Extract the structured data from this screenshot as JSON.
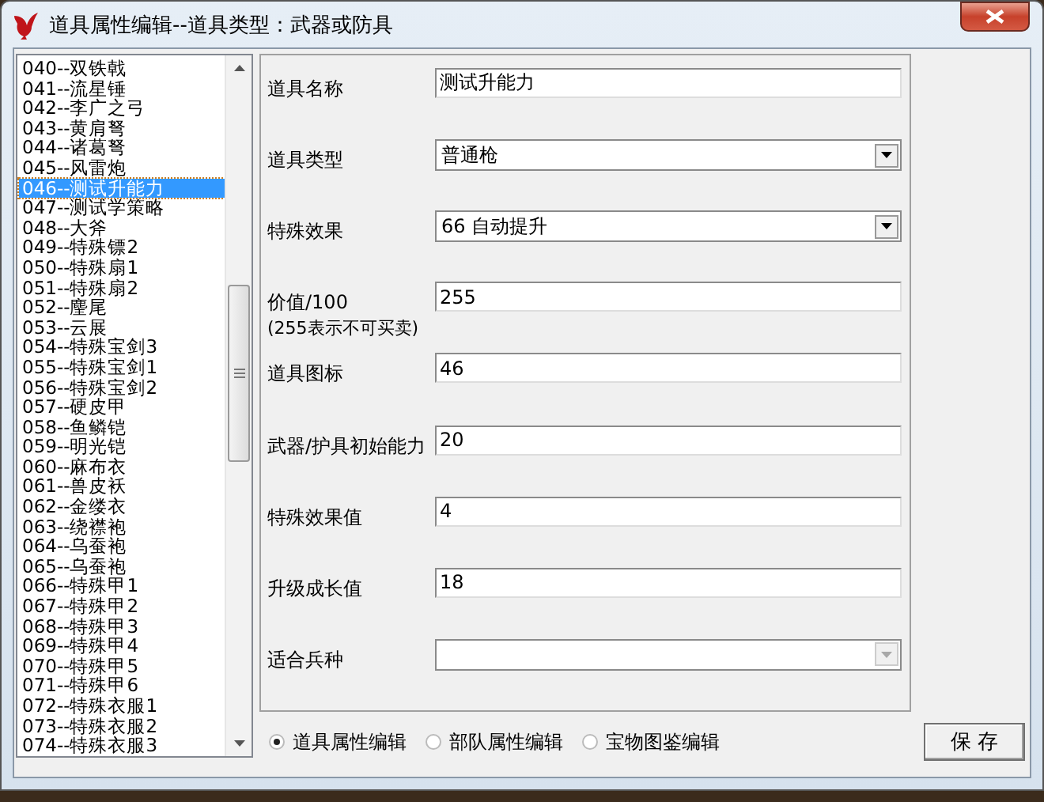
{
  "window": {
    "title": "道具属性编辑--道具类型：武器或防具"
  },
  "items": [
    {
      "label": "040--双铁戟",
      "selected": false
    },
    {
      "label": "041--流星锤",
      "selected": false
    },
    {
      "label": "042--李广之弓",
      "selected": false
    },
    {
      "label": "043--黄肩弩",
      "selected": false
    },
    {
      "label": "044--诸葛弩",
      "selected": false
    },
    {
      "label": "045--风雷炮",
      "selected": false
    },
    {
      "label": "046--测试升能力",
      "selected": true
    },
    {
      "label": "047--测试学策略",
      "selected": false
    },
    {
      "label": "048--大斧",
      "selected": false
    },
    {
      "label": "049--特殊镖2",
      "selected": false
    },
    {
      "label": "050--特殊扇1",
      "selected": false
    },
    {
      "label": "051--特殊扇2",
      "selected": false
    },
    {
      "label": "052--麈尾",
      "selected": false
    },
    {
      "label": "053--云展",
      "selected": false
    },
    {
      "label": "054--特殊宝剑3",
      "selected": false
    },
    {
      "label": "055--特殊宝剑1",
      "selected": false
    },
    {
      "label": "056--特殊宝剑2",
      "selected": false
    },
    {
      "label": "057--硬皮甲",
      "selected": false
    },
    {
      "label": "058--鱼鳞铠",
      "selected": false
    },
    {
      "label": "059--明光铠",
      "selected": false
    },
    {
      "label": "060--麻布衣",
      "selected": false
    },
    {
      "label": "061--兽皮袄",
      "selected": false
    },
    {
      "label": "062--金缕衣",
      "selected": false
    },
    {
      "label": "063--绕襟袍",
      "selected": false
    },
    {
      "label": "064--乌蚕袍",
      "selected": false
    },
    {
      "label": "065--乌蚕袍",
      "selected": false
    },
    {
      "label": "066--特殊甲1",
      "selected": false
    },
    {
      "label": "067--特殊甲2",
      "selected": false
    },
    {
      "label": "068--特殊甲3",
      "selected": false
    },
    {
      "label": "069--特殊甲4",
      "selected": false
    },
    {
      "label": "070--特殊甲5",
      "selected": false
    },
    {
      "label": "071--特殊甲6",
      "selected": false
    },
    {
      "label": "072--特殊衣服1",
      "selected": false
    },
    {
      "label": "073--特殊衣服2",
      "selected": false
    },
    {
      "label": "074--特殊衣服3",
      "selected": false
    }
  ],
  "fields": [
    {
      "kind": "text",
      "label": "道具名称",
      "value": "测试升能力"
    },
    {
      "kind": "combo",
      "label": "道具类型",
      "value": "普通枪",
      "disabled": false
    },
    {
      "kind": "combo",
      "label": "特殊效果",
      "value": "66 自动提升",
      "disabled": false
    },
    {
      "kind": "text",
      "label": "价值/100",
      "note": "(255表示不可买卖)",
      "value": "255"
    },
    {
      "kind": "text",
      "label": "道具图标",
      "value": "46"
    },
    {
      "kind": "text",
      "label": "武器/护具初始能力",
      "value": "20"
    },
    {
      "kind": "text",
      "label": "特殊效果值",
      "value": "4"
    },
    {
      "kind": "text",
      "label": "升级成长值",
      "value": "18"
    },
    {
      "kind": "combo",
      "label": "适合兵种",
      "disabled": true
    }
  ],
  "modes": [
    {
      "label": "道具属性编辑",
      "selected": true
    },
    {
      "label": "部队属性编辑",
      "selected": false
    },
    {
      "label": "宝物图鉴编辑",
      "selected": false
    }
  ],
  "save_button": "保 存"
}
